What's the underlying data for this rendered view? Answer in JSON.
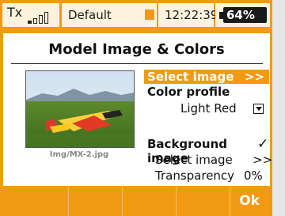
{
  "status_bar": {
    "tx_label": "Tx",
    "model_name": "Default",
    "time": "12:22:39",
    "battery_percent": "64%",
    "signal_level": 0.25
  },
  "page": {
    "title": "Model Image & Colors"
  },
  "image": {
    "caption": "Img/MX-2.jpg"
  },
  "options": {
    "select_image_label": "Select image",
    "select_image_arrow": ">>",
    "color_profile_label": "Color profile",
    "color_profile_value": "Light Red",
    "background_image_label": "Background image",
    "background_image_checked": "✓",
    "bg_select_image_label": "Select image",
    "bg_select_image_arrow": ">>",
    "transparency_label": "Transparency",
    "transparency_value": "0%"
  },
  "footer": {
    "ok_label": "Ok"
  },
  "colors": {
    "accent": "#f29a11",
    "panel": "#fdf3dc",
    "content_bg": "#ffffff"
  }
}
